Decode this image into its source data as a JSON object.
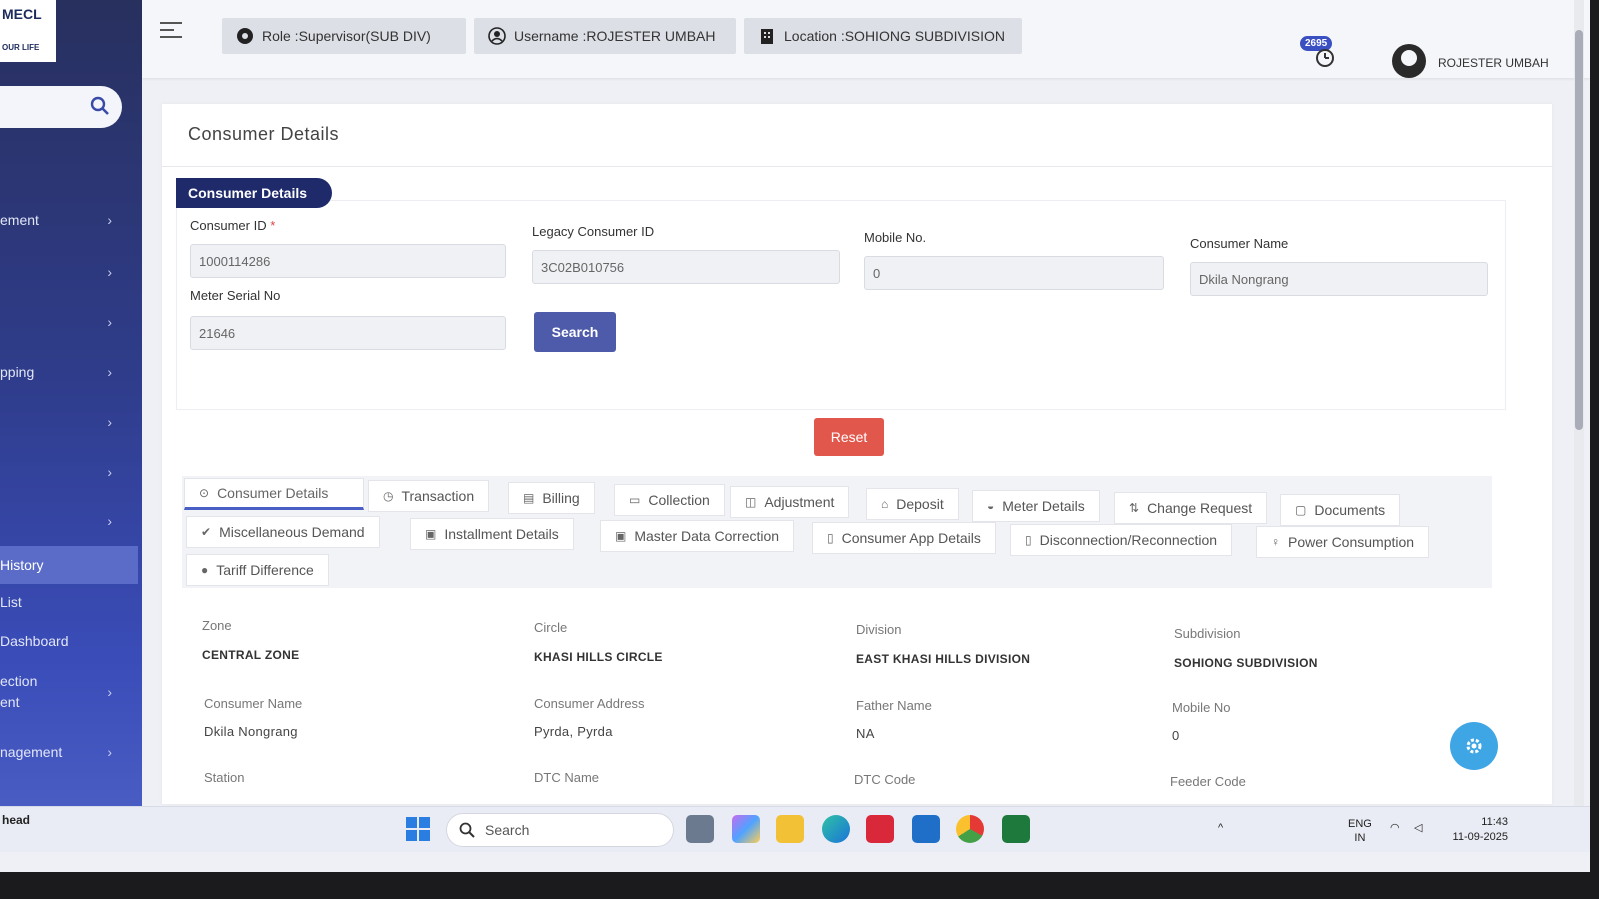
{
  "sidebar": {
    "logo_text": "MECL",
    "logo_sub": "OUR LIFE",
    "items": [
      {
        "label": "ement"
      },
      {
        "label": ""
      },
      {
        "label": ""
      },
      {
        "label": "pping"
      },
      {
        "label": ""
      },
      {
        "label": ""
      },
      {
        "label": ""
      },
      {
        "label": "History"
      },
      {
        "label": "List"
      },
      {
        "label": "Dashboard"
      },
      {
        "label": "ection\nent"
      },
      {
        "label": "nagement"
      }
    ]
  },
  "topbar": {
    "role": "Role :Supervisor(SUB DIV)",
    "username": "Username :ROJESTER UMBAH",
    "location": "Location :SOHIONG SUBDIVISION",
    "notification_count": "2695",
    "user_display_name": "ROJESTER UMBAH"
  },
  "page": {
    "title": "Consumer Details",
    "section_tag": "Consumer Details"
  },
  "form": {
    "consumer_id_label": "Consumer ID",
    "consumer_id_required": "*",
    "consumer_id_value": "1000114286",
    "legacy_id_label": "Legacy Consumer ID",
    "legacy_id_value": "3C02B010756",
    "mobile_label": "Mobile No.",
    "mobile_value": "0",
    "consumer_name_label": "Consumer Name",
    "consumer_name_value": "Dkila Nongrang",
    "meter_serial_label": "Meter Serial No",
    "meter_serial_value": "21646",
    "search_label": "Search",
    "reset_label": "Reset"
  },
  "tabs": [
    {
      "label": "Consumer Details",
      "icon": "⊙"
    },
    {
      "label": "Transaction",
      "icon": "◷"
    },
    {
      "label": "Billing",
      "icon": "▤"
    },
    {
      "label": "Collection",
      "icon": "▭"
    },
    {
      "label": "Adjustment",
      "icon": "◫"
    },
    {
      "label": "Deposit",
      "icon": "⌂"
    },
    {
      "label": "Meter Details",
      "icon": "◒"
    },
    {
      "label": "Change Request",
      "icon": "⇅"
    },
    {
      "label": "Documents",
      "icon": "▢"
    },
    {
      "label": "Miscellaneous Demand",
      "icon": "✔"
    },
    {
      "label": "Installment Details",
      "icon": "▣"
    },
    {
      "label": "Master Data Correction",
      "icon": "▣"
    },
    {
      "label": "Consumer App Details",
      "icon": "▯"
    },
    {
      "label": "Disconnection/Reconnection",
      "icon": "▯"
    },
    {
      "label": "Power Consumption",
      "icon": "♀"
    },
    {
      "label": "Tariff Difference",
      "icon": "●"
    }
  ],
  "details": {
    "zone_label": "Zone",
    "zone_value": "CENTRAL ZONE",
    "circle_label": "Circle",
    "circle_value": "KHASI HILLS CIRCLE",
    "division_label": "Division",
    "division_value": "EAST KHASI HILLS DIVISION",
    "subdivision_label": "Subdivision",
    "subdivision_value": "SOHIONG SUBDIVISION",
    "consumer_name_label": "Consumer Name",
    "consumer_name_value": "Dkila Nongrang",
    "address_label": "Consumer Address",
    "address_value": "Pyrda, Pyrda",
    "father_label": "Father Name",
    "father_value": "NA",
    "mobile_label": "Mobile No",
    "mobile_value": "0",
    "station_label": "Station",
    "dtc_name_label": "DTC Name",
    "dtc_code_label": "DTC Code",
    "feeder_label": "Feeder Code"
  },
  "taskbar": {
    "left_text": "head",
    "search_placeholder": "Search",
    "lang": "ENG",
    "region": "IN",
    "time": "11:43",
    "date": "11-09-2025"
  }
}
